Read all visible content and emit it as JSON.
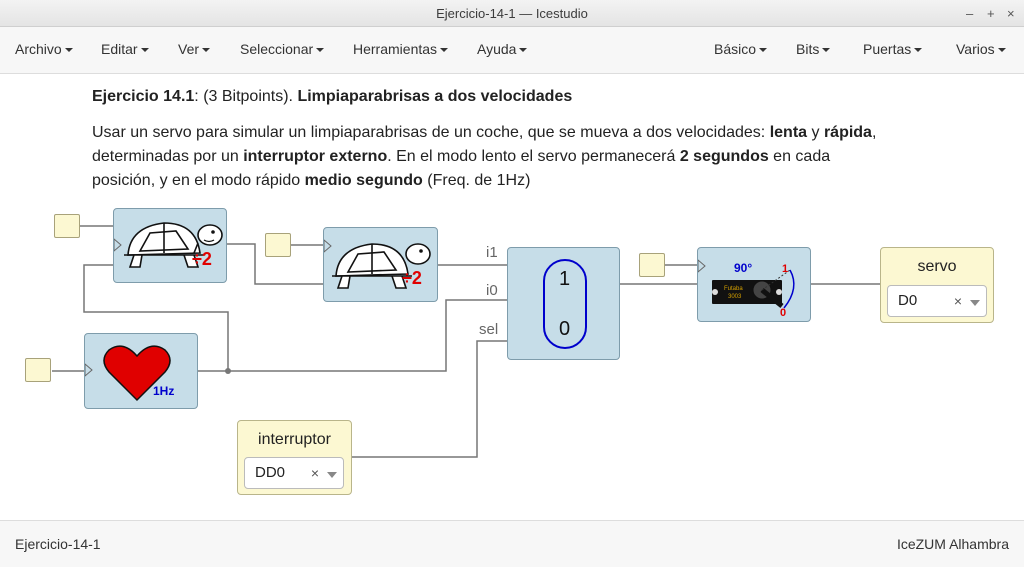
{
  "window": {
    "title": "Ejercicio-14-1 — Icestudio"
  },
  "menubar": {
    "left": [
      {
        "label": "Archivo"
      },
      {
        "label": "Editar"
      },
      {
        "label": "Ver"
      },
      {
        "label": "Seleccionar"
      },
      {
        "label": "Herramientas"
      },
      {
        "label": "Ayuda"
      }
    ],
    "right": [
      {
        "label": "Básico"
      },
      {
        "label": "Bits"
      },
      {
        "label": "Puertas"
      },
      {
        "label": "Varios"
      }
    ]
  },
  "description": {
    "title_bold": "Ejercicio 14.1",
    "title_mid": ": (3 Bitpoints). ",
    "title_bold2": "Limpiaparabrisas a dos velocidades",
    "p1": "Usar un servo para simular un limpiaparabrisas de un coche, que se mueva a dos velocidades: ",
    "p1_b1": "lenta",
    "p1_t2": " y ",
    "p1_b2": "rápida",
    "p1_t3": ", determinadas por un ",
    "p1_b3": "interruptor externo",
    "p1_t4": ". En el modo lento el servo permanecerá ",
    "p1_b4": "2 segundos",
    "p1_t5": " en cada posición, y en el modo rápido ",
    "p1_b5": "medio segundo",
    "p1_t6": " (Freq. de 1Hz)"
  },
  "blocks": {
    "div1": {
      "label": "÷2",
      "icon": "turtle-icon"
    },
    "div2": {
      "label": "÷2",
      "icon": "turtle-icon"
    },
    "clock": {
      "label": "1Hz",
      "icon": "heart-icon"
    },
    "mux": {
      "top": "1",
      "bottom": "0",
      "ports": [
        "i1",
        "i0",
        "sel"
      ]
    },
    "servo_block": {
      "angle": "90°",
      "brand": "Futaba",
      "model": "3003",
      "mark1": "1",
      "mark0": "0"
    }
  },
  "outputs": {
    "servo": {
      "label": "servo",
      "value": "D0",
      "clear": "×"
    }
  },
  "inputs": {
    "interruptor": {
      "label": "interruptor",
      "value": "DD0",
      "clear": "×"
    }
  },
  "statusbar": {
    "left": "Ejercicio-14-1",
    "right": "IceZUM Alhambra"
  },
  "colors": {
    "block": "#c6dde8",
    "io": "#fcf8d2",
    "wire": "#777777",
    "accent": "#0000cc",
    "heart": "#e00000"
  }
}
